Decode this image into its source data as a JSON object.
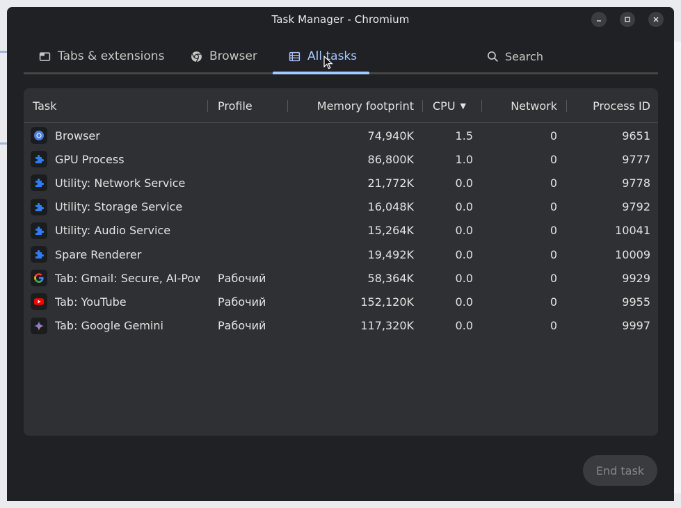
{
  "window": {
    "title": "Task Manager - Chromium"
  },
  "tabs": [
    {
      "label": "Tabs & extensions",
      "icon": "tab-icon",
      "active": false
    },
    {
      "label": "Browser",
      "icon": "chrome-icon",
      "active": false
    },
    {
      "label": "All tasks",
      "icon": "list-icon",
      "active": true
    }
  ],
  "search": {
    "label": "Search",
    "icon": "search-icon"
  },
  "table": {
    "columns": [
      "Task",
      "Profile",
      "Memory footprint",
      "CPU",
      "Network",
      "Process ID"
    ],
    "sort_indicator": "▼",
    "rows": [
      {
        "icon": "chromium-icon",
        "task": "Browser",
        "profile": "",
        "memory": "74,940K",
        "cpu": "1.5",
        "network": "0",
        "pid": "9651"
      },
      {
        "icon": "puzzle-icon",
        "task": "GPU Process",
        "profile": "",
        "memory": "86,800K",
        "cpu": "1.0",
        "network": "0",
        "pid": "9777"
      },
      {
        "icon": "puzzle-icon",
        "task": "Utility: Network Service",
        "profile": "",
        "memory": "21,772K",
        "cpu": "0.0",
        "network": "0",
        "pid": "9778"
      },
      {
        "icon": "puzzle-icon",
        "task": "Utility: Storage Service",
        "profile": "",
        "memory": "16,048K",
        "cpu": "0.0",
        "network": "0",
        "pid": "9792"
      },
      {
        "icon": "puzzle-icon",
        "task": "Utility: Audio Service",
        "profile": "",
        "memory": "15,264K",
        "cpu": "0.0",
        "network": "0",
        "pid": "10041"
      },
      {
        "icon": "puzzle-icon",
        "task": "Spare Renderer",
        "profile": "",
        "memory": "19,492K",
        "cpu": "0.0",
        "network": "0",
        "pid": "10009"
      },
      {
        "icon": "google-icon",
        "task": "Tab: Gmail: Secure, AI-Powe",
        "profile": "Рабочий",
        "memory": "58,364K",
        "cpu": "0.0",
        "network": "0",
        "pid": "9929"
      },
      {
        "icon": "youtube-icon",
        "task": "Tab: YouTube",
        "profile": "Рабочий",
        "memory": "152,120K",
        "cpu": "0.0",
        "network": "0",
        "pid": "9955"
      },
      {
        "icon": "gemini-icon",
        "task": "Tab: Google Gemini",
        "profile": "Рабочий",
        "memory": "117,320K",
        "cpu": "0.0",
        "network": "0",
        "pid": "9997"
      }
    ]
  },
  "actions": {
    "end_task": "End task"
  },
  "colors": {
    "accent": "#a8c7fa",
    "background": "#202124",
    "table_bg": "#2f3034",
    "puzzle_blue": "#2e7df2"
  }
}
